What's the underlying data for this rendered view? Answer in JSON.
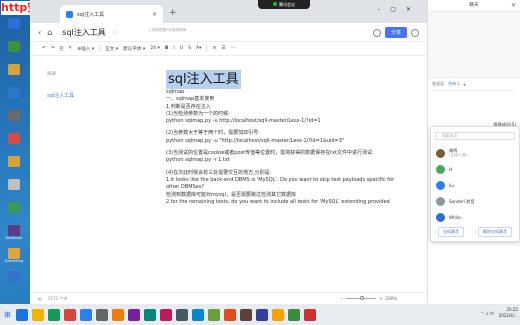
{
  "watermark": "http安全",
  "desktop_icons": [
    {
      "label": "",
      "color": "#2a6fd6"
    },
    {
      "label": "",
      "color": "#3c8f3c"
    },
    {
      "label": "",
      "color": "#d9a33a"
    },
    {
      "label": "",
      "color": "#2b77c9"
    },
    {
      "label": "",
      "color": "#6a6a6a"
    },
    {
      "label": "",
      "color": "#d64a4a"
    },
    {
      "label": "",
      "color": "#d9a33a"
    },
    {
      "label": "",
      "color": "#c0c0c0"
    },
    {
      "label": "",
      "color": "#3b9a58"
    },
    {
      "label": "Bandicam",
      "color": "#5b3a8a"
    },
    {
      "label": "Everything",
      "color": "#e6a23c"
    },
    {
      "label": "",
      "color": "#3572c9"
    }
  ],
  "browser": {
    "tab_title": "sql注入工具",
    "recording_badge": "腾讯会议"
  },
  "doc": {
    "title": "sql注入工具",
    "cloud_status": "上次修改是2天前的时间",
    "share_label": "分享",
    "toolbar": [
      "↶",
      "↷",
      "⎘",
      "✎",
      "⊕插入 ▾",
      "|",
      "正文 ▾",
      "默认字体 ▾",
      "24 ▾",
      "B",
      "I",
      "U",
      "S",
      "A▾",
      "|",
      "≡",
      "☰",
      "⋯"
    ],
    "outline_title": "目录",
    "outline_item": "sql注入工具",
    "heading": "sql注入工具",
    "lines": [
      "sqlmap",
      "一、sqlmap基本使用",
      "1.判断是否存在注入",
      "(1)当检测参数为一个的时候:",
      "python sqlmap.py -u http://localhost/sqli-master/Less-1/?id=1",
      "",
      "(2)当参数大于等于两个时，需要加双引号:",
      "python sqlmap.py -u \"http://localhost/sqli-master/Less-1/?id=1&uid=3\"",
      "",
      "(3)当测试的位置是cookie或者post传值等位置时，需将获得的数据保存在txt文件中进行测试:",
      "python sqlmap.py -r 1.txt",
      "",
      "(4)在次此时候会有三处需要交互的地方,分别是:",
      "1.it looks like the back-end DBMS is 'MySQL'. Do you want to skip test payloads specific for",
      "other DBMSes?",
      "检测到数据库可能对mysql，是否需要跳过检测其它数据库",
      "2.for the remaining tests, do you want to include all tests for 'MySQL' extending provided"
    ],
    "word_count": "1173 个字",
    "zoom": "100%"
  },
  "panel": {
    "title": "聊天",
    "send_to_label": "发送至:",
    "send_to_value": "所有人",
    "manage_label": "管理成员(5)",
    "search_placeholder": "搜索成员",
    "members": [
      {
        "name": "胡鸣",
        "tag": "(主持人,我)",
        "color": "#7a5c3a"
      },
      {
        "name": "H",
        "tag": "",
        "color": "#4aa860"
      },
      {
        "name": "liu",
        "tag": "",
        "color": "#2d7df6"
      },
      {
        "name": "Sanderi 聆音",
        "tag": "",
        "color": "#8899aa"
      },
      {
        "name": "While.",
        "tag": "",
        "color": "#2d6fd6"
      }
    ],
    "mute_all": "全体静音",
    "unmute_all": "解除全体静音"
  },
  "taskbar": {
    "time": "20:22",
    "date": "2022/4/...",
    "apps": [
      "#1a73e8",
      "#f0b400",
      "#0f9d58",
      "#db4437",
      "#2d7df6",
      "#666666",
      "#f57c00",
      "#7b1fa2",
      "#00897b",
      "#c2185b",
      "#455a64",
      "#0288d1",
      "#689f38",
      "#e64a19",
      "#5d4037",
      "#303f9f",
      "#ffa000",
      "#388e3c",
      "#d32f2f"
    ]
  }
}
